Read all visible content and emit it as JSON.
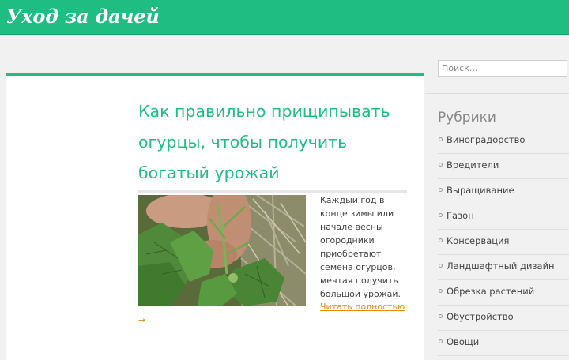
{
  "header": {
    "site_title": "Уход за дачей"
  },
  "post": {
    "title": "Как правильно прищипывать огурцы, чтобы получить богатый урожай",
    "excerpt": "Каждый год в конце зимы или начале весны огородники приобретают семена огурцов, мечтая получить большой урожай.",
    "read_more": "Читать полностью",
    "read_arrow": "→"
  },
  "sidebar": {
    "search_placeholder": "Поиск...",
    "categories_title": "Рубрики",
    "categories": [
      {
        "label": "Виноградорство"
      },
      {
        "label": "Вредители"
      },
      {
        "label": "Выращивание"
      },
      {
        "label": "Газон"
      },
      {
        "label": "Консервация"
      },
      {
        "label": "Ландшафтный дизайн"
      },
      {
        "label": "Обрезка растений"
      },
      {
        "label": "Обустройство"
      },
      {
        "label": "Овощи"
      }
    ]
  }
}
